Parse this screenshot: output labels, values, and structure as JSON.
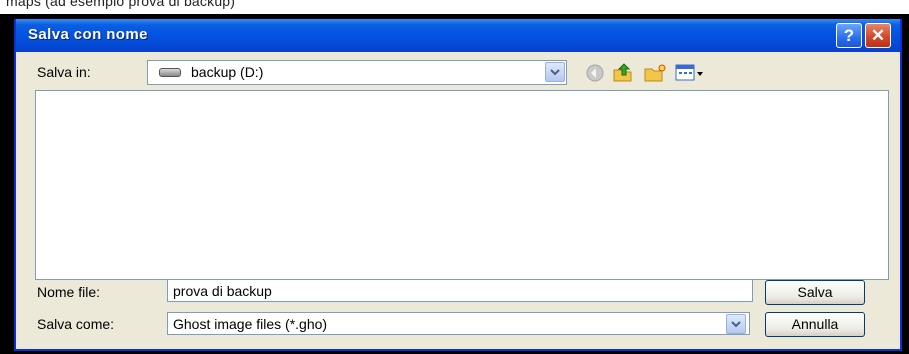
{
  "page_caption": "maps (ad esempio prova di backup)",
  "window": {
    "title": "Salva con nome",
    "help_glyph": "?",
    "close_glyph": "✕"
  },
  "toolbar": {
    "save_in_label": "Salva in:",
    "location_value": "backup (D:)",
    "icons": [
      "drive-icon",
      "back-icon",
      "up-folder-icon",
      "new-folder-icon",
      "view-menu-icon"
    ]
  },
  "file_list": {
    "items": []
  },
  "filename": {
    "label": "Nome file:",
    "value": "prova di backup"
  },
  "filetype": {
    "label": "Salva come:",
    "value": "Ghost image files (*.gho)"
  },
  "buttons": {
    "save": "Salva",
    "cancel": "Annulla"
  },
  "colors": {
    "titlebar": "#0454e2",
    "dialog_bg": "#ece9d8",
    "field_border": "#7f9db9"
  }
}
